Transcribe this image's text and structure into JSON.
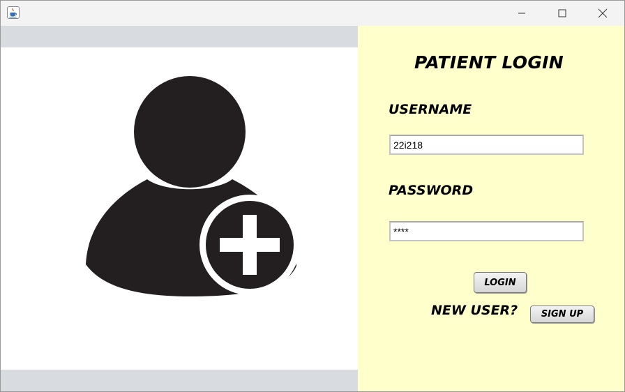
{
  "window": {
    "title": "",
    "icon": "java-cup-icon",
    "controls": [
      "minimize-icon",
      "maximize-icon",
      "close-icon"
    ]
  },
  "illustration": {
    "icon": "add-user-icon",
    "fill_color": "#231f20"
  },
  "form": {
    "title": "PATIENT LOGIN",
    "username_label": "USERNAME",
    "username_value": "22i218",
    "password_label": "PASSWORD",
    "password_value": "****",
    "login_label": "LOGIN",
    "new_user_label": "NEW USER?",
    "signup_label": "SIGN UP"
  },
  "colors": {
    "form_background": "#ffffcc",
    "side_band": "#d8dbe0",
    "titlebar": "#f3f3f3"
  }
}
